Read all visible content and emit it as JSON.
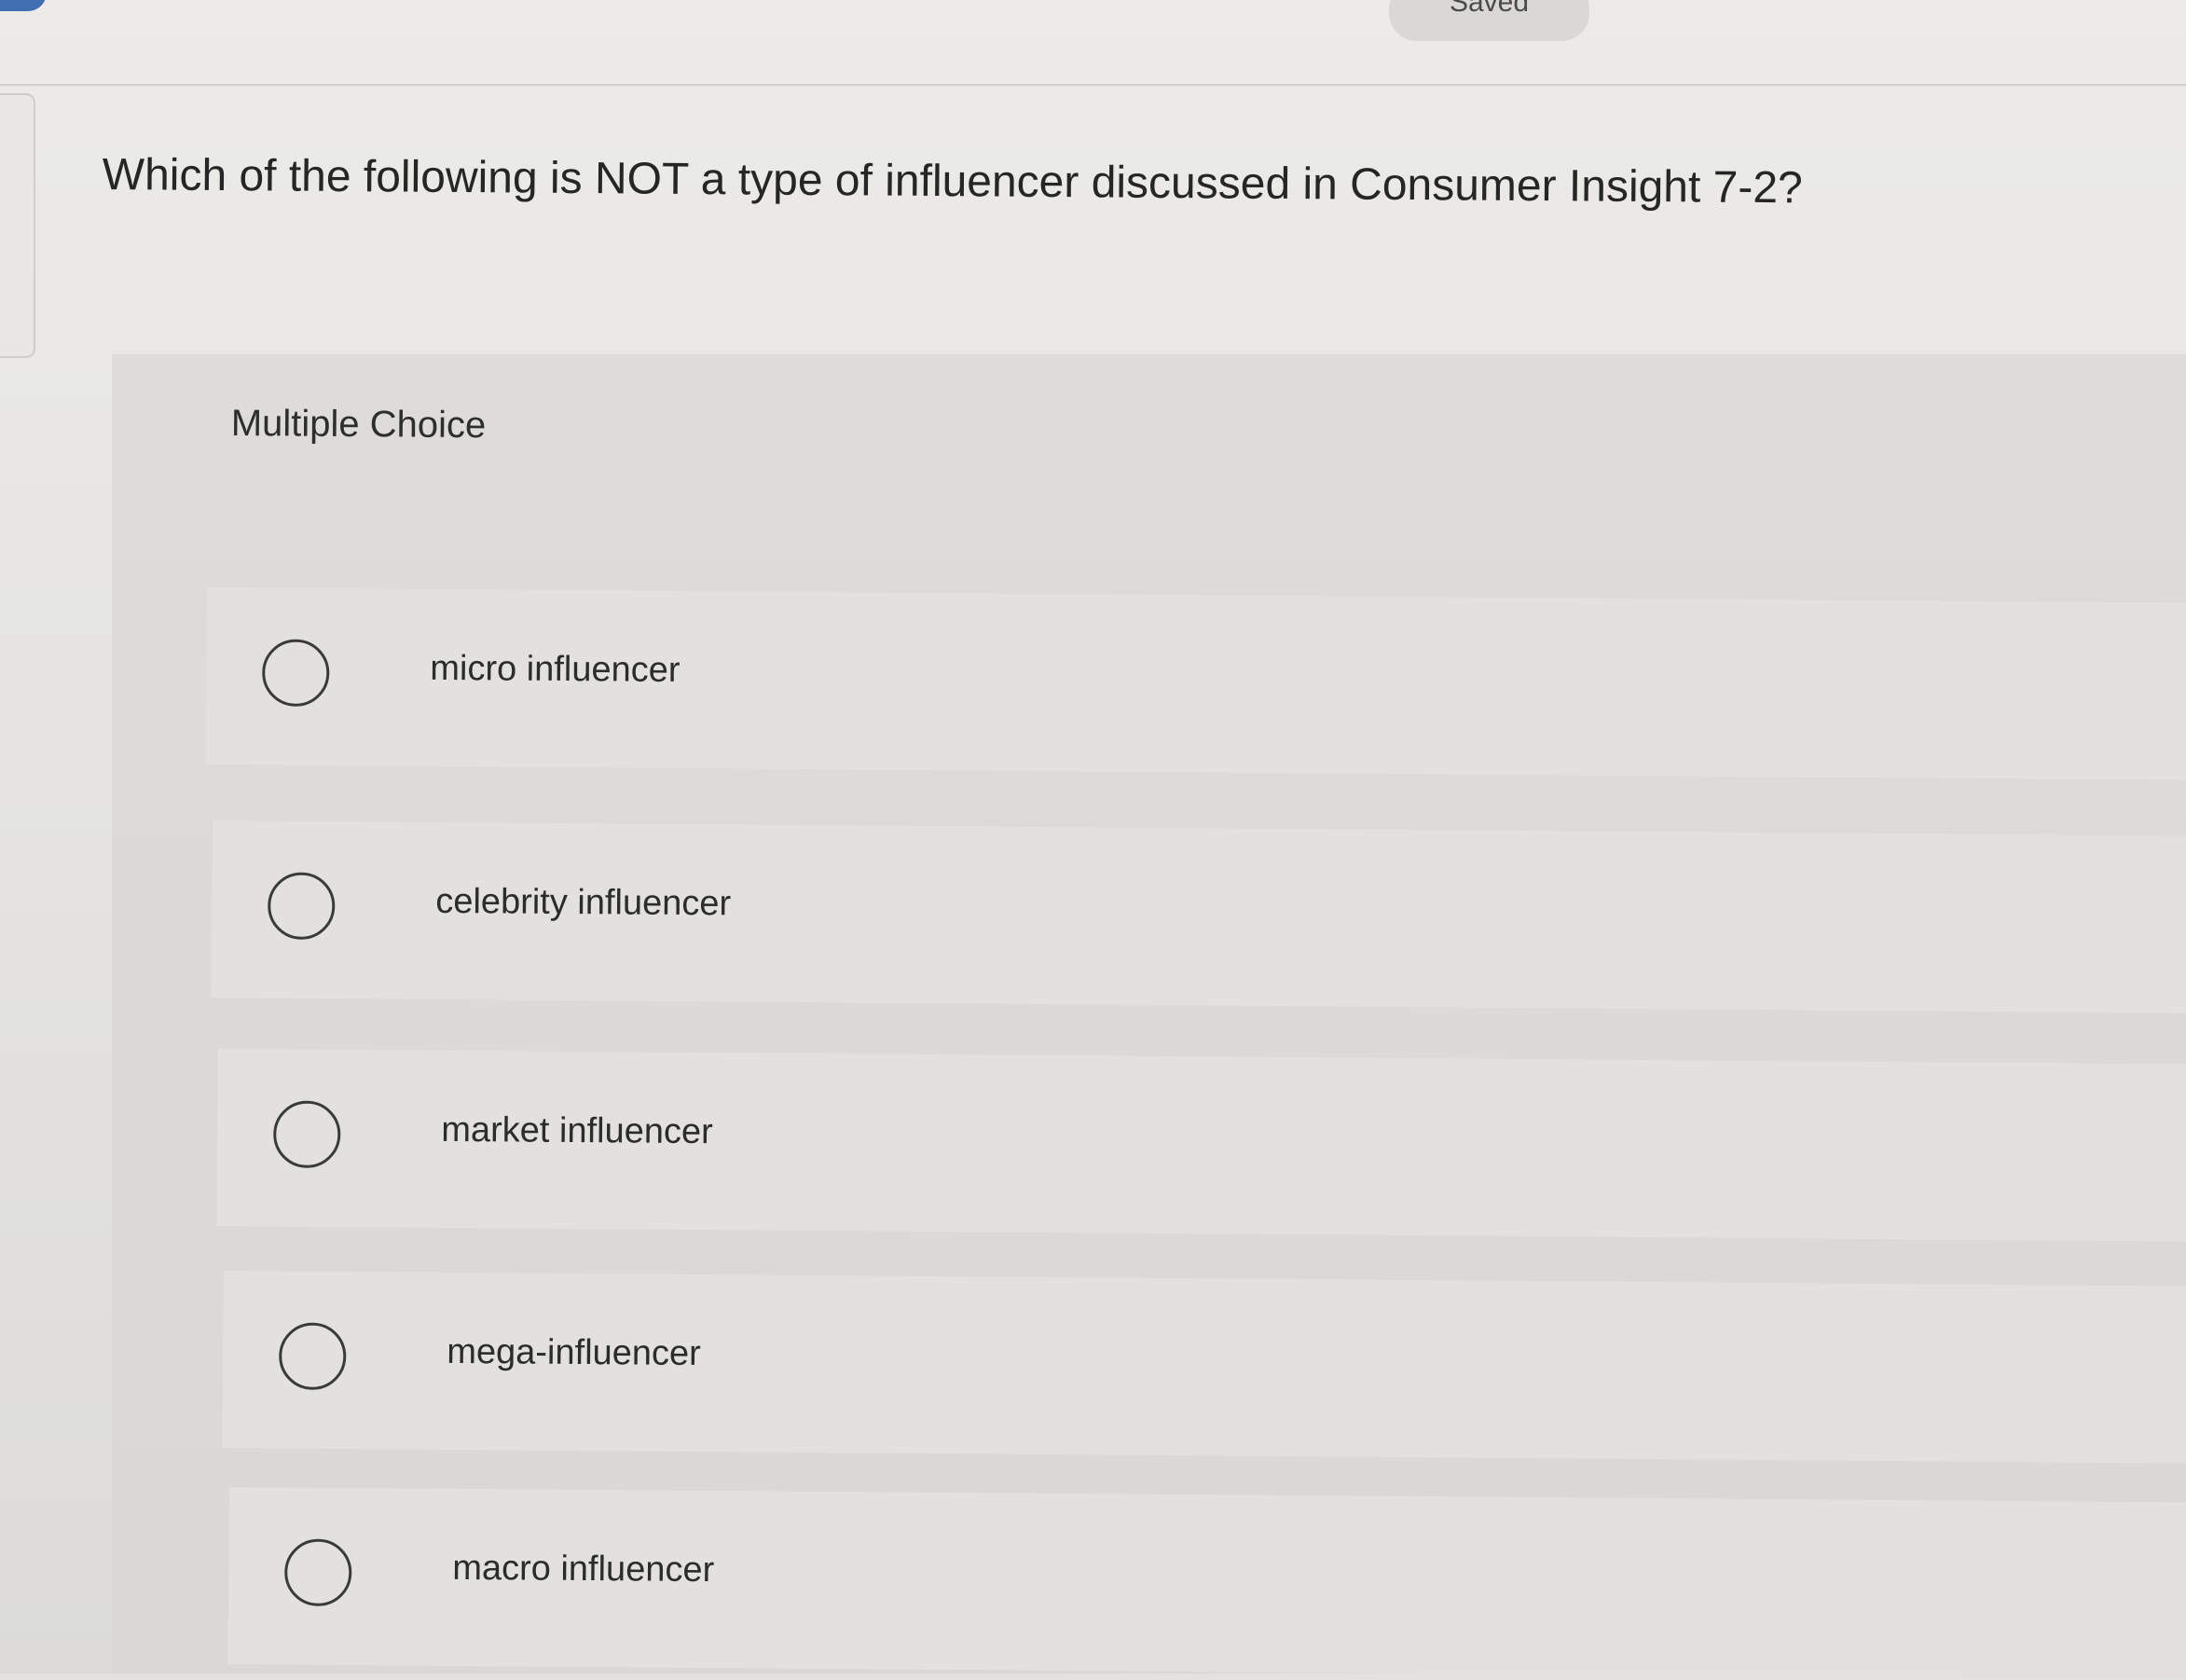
{
  "header": {
    "status_label": "Saved"
  },
  "question": {
    "text": "Which of the following is NOT a type of influencer discussed in Consumer Insight 7-2?",
    "type_label": "Multiple Choice"
  },
  "options": [
    {
      "label": "micro influencer",
      "selected": false
    },
    {
      "label": "celebrity influencer",
      "selected": false
    },
    {
      "label": "market influencer",
      "selected": false
    },
    {
      "label": "mega-influencer",
      "selected": false
    },
    {
      "label": "macro influencer",
      "selected": false
    }
  ],
  "colors": {
    "accent": "#3f6fb0",
    "background": "#e3e2de",
    "text": "#2b2b2b"
  }
}
